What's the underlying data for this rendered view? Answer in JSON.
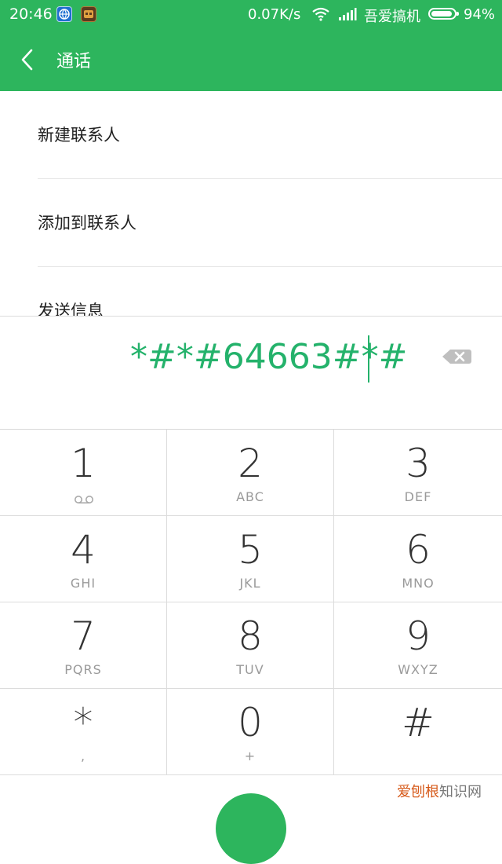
{
  "status_bar": {
    "time": "20:46",
    "speed": "0.07K/s",
    "carrier": "吾爱搞机",
    "battery_percent": "94%",
    "battery_level": 0.94,
    "icons": [
      "browser-app-icon",
      "game-app-icon",
      "wifi-icon",
      "signal-icon",
      "battery-icon"
    ]
  },
  "header": {
    "title": "通话",
    "back_icon": "chevron-left-icon"
  },
  "options": [
    {
      "label": "新建联系人"
    },
    {
      "label": "添加到联系人"
    },
    {
      "label": "发送信息"
    }
  ],
  "dialer": {
    "number": "*#*#64663#*#",
    "backspace_icon": "backspace-icon"
  },
  "keypad": {
    "keys": [
      {
        "digit": "1",
        "letters": "",
        "sub_icon": "voicemail-icon"
      },
      {
        "digit": "2",
        "letters": "ABC"
      },
      {
        "digit": "3",
        "letters": "DEF"
      },
      {
        "digit": "4",
        "letters": "GHI"
      },
      {
        "digit": "5",
        "letters": "JKL"
      },
      {
        "digit": "6",
        "letters": "MNO"
      },
      {
        "digit": "7",
        "letters": "PQRS"
      },
      {
        "digit": "8",
        "letters": "TUV"
      },
      {
        "digit": "9",
        "letters": "WXYZ"
      },
      {
        "digit": "*",
        "letters": ","
      },
      {
        "digit": "0",
        "letters": "+"
      },
      {
        "digit": "#",
        "letters": ""
      }
    ]
  },
  "watermark": {
    "highlight": "爱刨根",
    "rest": "知识网"
  },
  "colors": {
    "accent": "#2db55d",
    "dial_text": "#24b26b"
  }
}
